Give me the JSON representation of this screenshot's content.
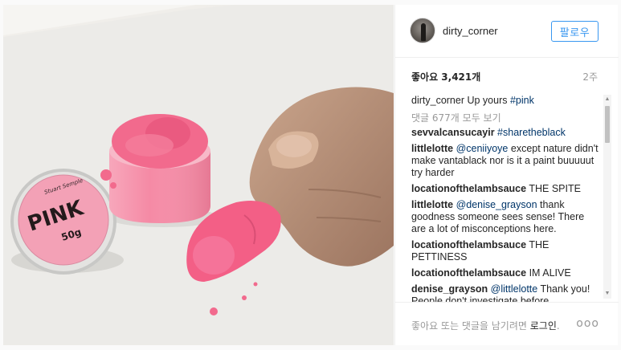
{
  "post": {
    "username": "dirty_corner",
    "follow_label": "팔로우",
    "likes": "좋아요 3,421개",
    "age": "2주",
    "caption": {
      "user": "dirty_corner",
      "text": "Up yours ",
      "hashtag": "#pink"
    },
    "view_all": "댓글 677개 모두 보기"
  },
  "comments": [
    {
      "user": "sevvalcansucayir",
      "mention": "",
      "text": "",
      "hashtag": "#sharetheblack"
    },
    {
      "user": "littlelotte",
      "mention": "@ceniiyoye",
      "text": " except nature didn't make vantablack nor is it a paint buuuuut try harder",
      "hashtag": ""
    },
    {
      "user": "locationofthelambsauce",
      "mention": "",
      "text": "THE SPITE",
      "hashtag": ""
    },
    {
      "user": "littlelotte",
      "mention": "@denise_grayson",
      "text": " thank goodness someone sees sense! There are a lot of misconceptions here.",
      "hashtag": ""
    },
    {
      "user": "locationofthelambsauce",
      "mention": "",
      "text": "THE PETTINESS",
      "hashtag": ""
    },
    {
      "user": "locationofthelambsauce",
      "mention": "",
      "text": "IM ALIVE",
      "hashtag": ""
    },
    {
      "user": "denise_grayson",
      "mention": "@littlelotte",
      "text": " Thank you! People don't investigate before",
      "hashtag": ""
    }
  ],
  "footer": {
    "prompt": "좋아요 또는 댓글을 남기려면 ",
    "login": "로그인",
    "period": ".",
    "more": "ooo"
  },
  "photo_lid": {
    "brand": "Stuart Semple",
    "product": "PINK",
    "weight": "50g"
  },
  "icons": {
    "more": "more-options-icon",
    "scroll_up": "scroll-up-arrow-icon",
    "scroll_down": "scroll-down-arrow-icon"
  },
  "colors": {
    "accent": "#3897f0",
    "pink": "#f26a8d",
    "text": "#262626",
    "muted": "#999999"
  }
}
